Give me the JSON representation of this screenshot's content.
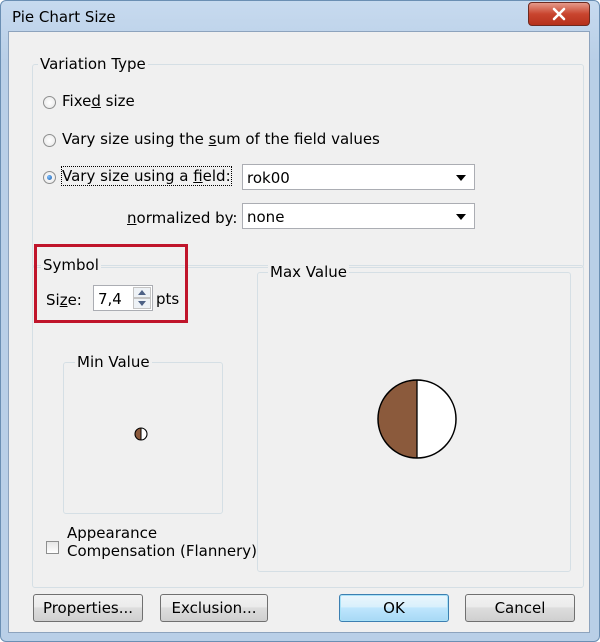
{
  "window": {
    "title": "Pie Chart Size"
  },
  "variation": {
    "legend": "Variation Type",
    "fixed_size": "Fixed size",
    "vary_sum": "Vary size using the sum of the field values",
    "vary_field": "Vary size using a field:",
    "selected": "vary_field",
    "field_value": "rok00",
    "normalized_label": "normalized by:",
    "normalized_value": "none"
  },
  "symbol": {
    "legend": "Symbol",
    "size_label": "Size:",
    "size_value": "7,4",
    "unit": "pts"
  },
  "min_value": {
    "legend": "Min Value"
  },
  "max_value": {
    "legend": "Max Value"
  },
  "appearance": {
    "label": "Appearance Compensation (Flannery)",
    "checked": false
  },
  "buttons": {
    "properties": "Properties...",
    "exclusion": "Exclusion...",
    "ok": "OK",
    "cancel": "Cancel"
  },
  "colors": {
    "pie_brown": "#8b5a3c",
    "highlight_red": "#c0152b",
    "dialog_bg": "#f0f0f0"
  }
}
